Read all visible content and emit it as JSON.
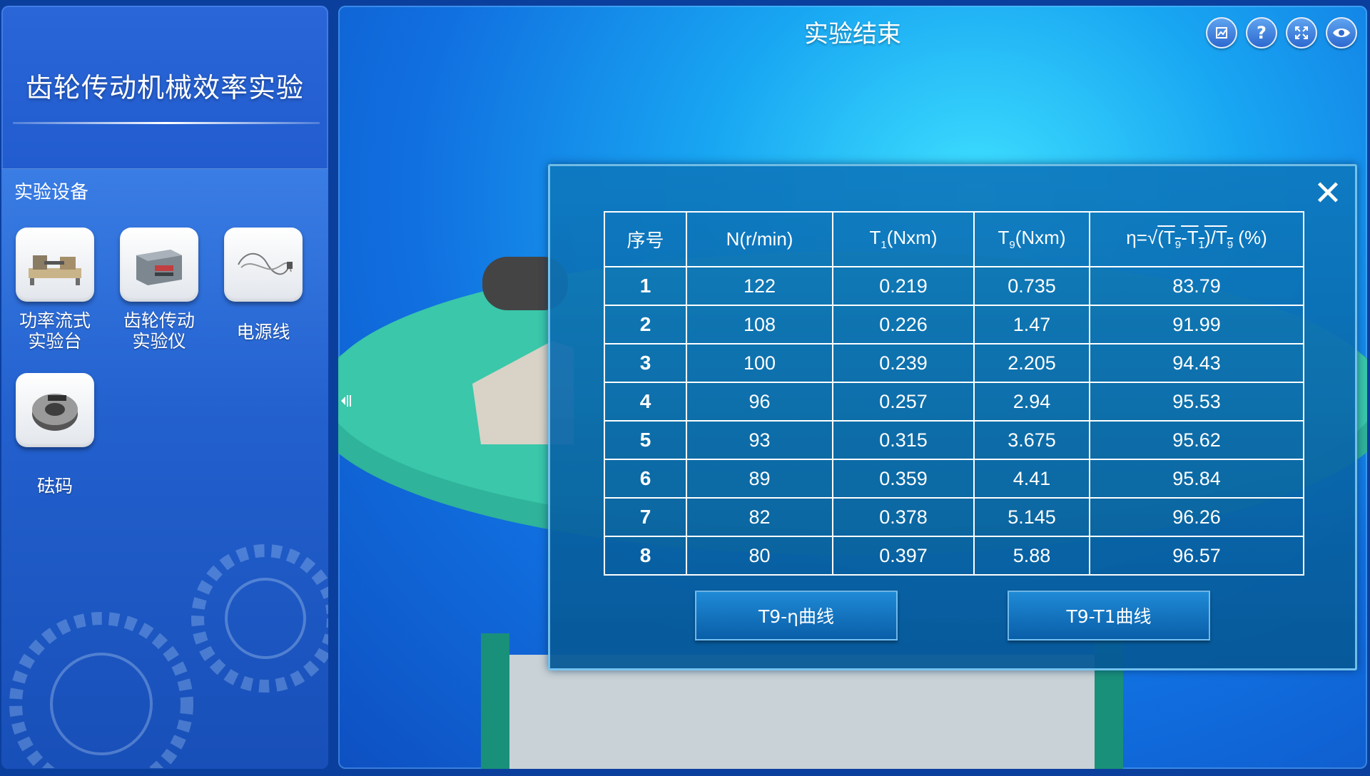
{
  "sidebar": {
    "app_title": "齿轮传动机械效率实验",
    "equipment_header": "实验设备",
    "equipment": [
      {
        "label_line1": "功率流式",
        "label_line2": "实验台",
        "icon": "test-bench-icon"
      },
      {
        "label_line1": "齿轮传动",
        "label_line2": "实验仪",
        "icon": "gear-instrument-icon"
      },
      {
        "label_line1": "电源线",
        "label_line2": "",
        "icon": "power-cord-icon"
      },
      {
        "label_line1": "砝码",
        "label_line2": "",
        "icon": "weight-icon"
      }
    ]
  },
  "header": {
    "title": "实验结束",
    "buttons": [
      "export-icon",
      "help-icon",
      "fullscreen-icon",
      "view-icon"
    ]
  },
  "dialog": {
    "columns": [
      "序号",
      "N(r/min)",
      "T1(Nxm)",
      "T9(Nxm)",
      "η=√(T9-T1)/T9 (%)"
    ],
    "col_labels": {
      "idx": "序号",
      "n": "N(r/min)",
      "t1_main": "T",
      "t1_sub": "1",
      "t1_unit": "(Nxm)",
      "t9_main": "T",
      "t9_sub": "9",
      "t9_unit": "(Nxm)",
      "eta_prefix": "η=",
      "eta_sqrt": "√",
      "eta_expr_a": "(T",
      "eta_sub9a": "9",
      "eta_expr_b": "-T",
      "eta_sub1": "1",
      "eta_expr_c": ")/T",
      "eta_sub9b": "9",
      "eta_unit": " (%)"
    },
    "rows": [
      [
        "1",
        "122",
        "0.219",
        "0.735",
        "83.79"
      ],
      [
        "2",
        "108",
        "0.226",
        "1.47",
        "91.99"
      ],
      [
        "3",
        "100",
        "0.239",
        "2.205",
        "94.43"
      ],
      [
        "4",
        "96",
        "0.257",
        "2.94",
        "95.53"
      ],
      [
        "5",
        "93",
        "0.315",
        "3.675",
        "95.62"
      ],
      [
        "6",
        "89",
        "0.359",
        "4.41",
        "95.84"
      ],
      [
        "7",
        "82",
        "0.378",
        "5.145",
        "96.26"
      ],
      [
        "8",
        "80",
        "0.397",
        "5.88",
        "96.57"
      ]
    ],
    "button_eta_curve": "T9-η曲线",
    "button_t1_curve": "T9-T1曲线",
    "close_icon": "close-icon"
  }
}
